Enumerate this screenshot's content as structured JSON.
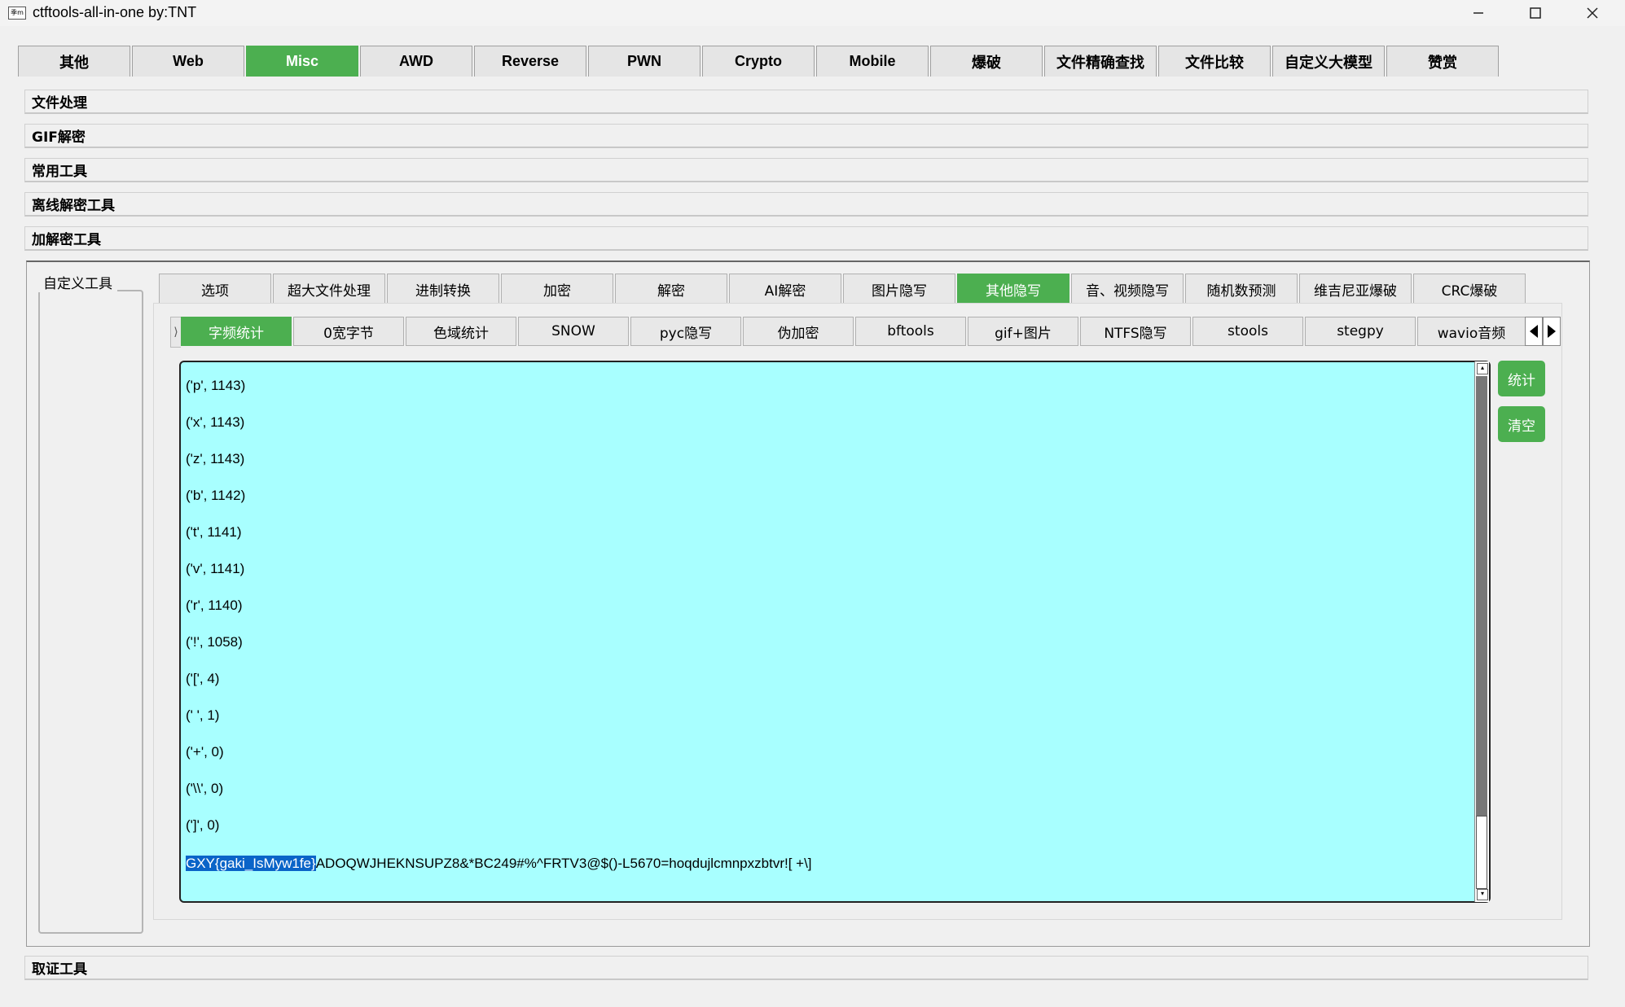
{
  "window": {
    "title": "ctftools-all-in-one    by:TNT",
    "icon_text": "季m",
    "min_icon": "minimize-icon",
    "max_icon": "maximize-icon",
    "close_icon": "close-icon"
  },
  "top_tabs": [
    "其他",
    "Web",
    "Misc",
    "AWD",
    "Reverse",
    "PWN",
    "Crypto",
    "Mobile",
    "爆破",
    "文件精确查找",
    "文件比较",
    "自定义大模型",
    "赞赏"
  ],
  "top_tabs_active": "Misc",
  "sections": {
    "file_processing": "文件处理",
    "gif_decrypt": "GIF解密",
    "common_tools": "常用工具",
    "offline_decrypt": "离线解密工具",
    "encrypt_decrypt": "加解密工具",
    "forensics": "取证工具"
  },
  "custom_tools_label": "自定义工具",
  "sub_tabs": [
    "选项",
    "超大文件处理",
    "进制转换",
    "加密",
    "解密",
    "AI解密",
    "图片隐写",
    "其他隐写",
    "音、视频隐写",
    "随机数预测",
    "维吉尼亚爆破",
    "CRC爆破"
  ],
  "sub_tabs_active": "其他隐写",
  "third_tabs": [
    "字频统计",
    "0宽字节",
    "色域统计",
    "SNOW",
    "pyc隐写",
    "伪加密",
    "bftools",
    "gif+图片",
    "NTFS隐写",
    "stools",
    "stegpy",
    "wavio音频"
  ],
  "third_tabs_active": "字频统计",
  "output": {
    "lines": [
      "('p', 1143)",
      "('x', 1143)",
      "('z', 1143)",
      "('b', 1142)",
      "('t', 1141)",
      "('v', 1141)",
      "('r', 1140)",
      "('!', 1058)",
      "('[', 4)",
      "(' ', 1)",
      "('+', 0)",
      "('\\\\', 0)",
      "(']', 0)"
    ],
    "final_selected": "GXY{gaki_IsMyw1fe}",
    "final_rest": "ADOQWJHEKNSUPZ8&*BC249#%^FRTV3@$()-L5670=hoqdujlcmnpxzbtvr![ +\\]"
  },
  "buttons": {
    "stat": "统计",
    "clear": "清空"
  },
  "colors": {
    "accent_green": "#4caf50",
    "output_bg": "#a8ffff",
    "selection": "#0a64c8"
  }
}
